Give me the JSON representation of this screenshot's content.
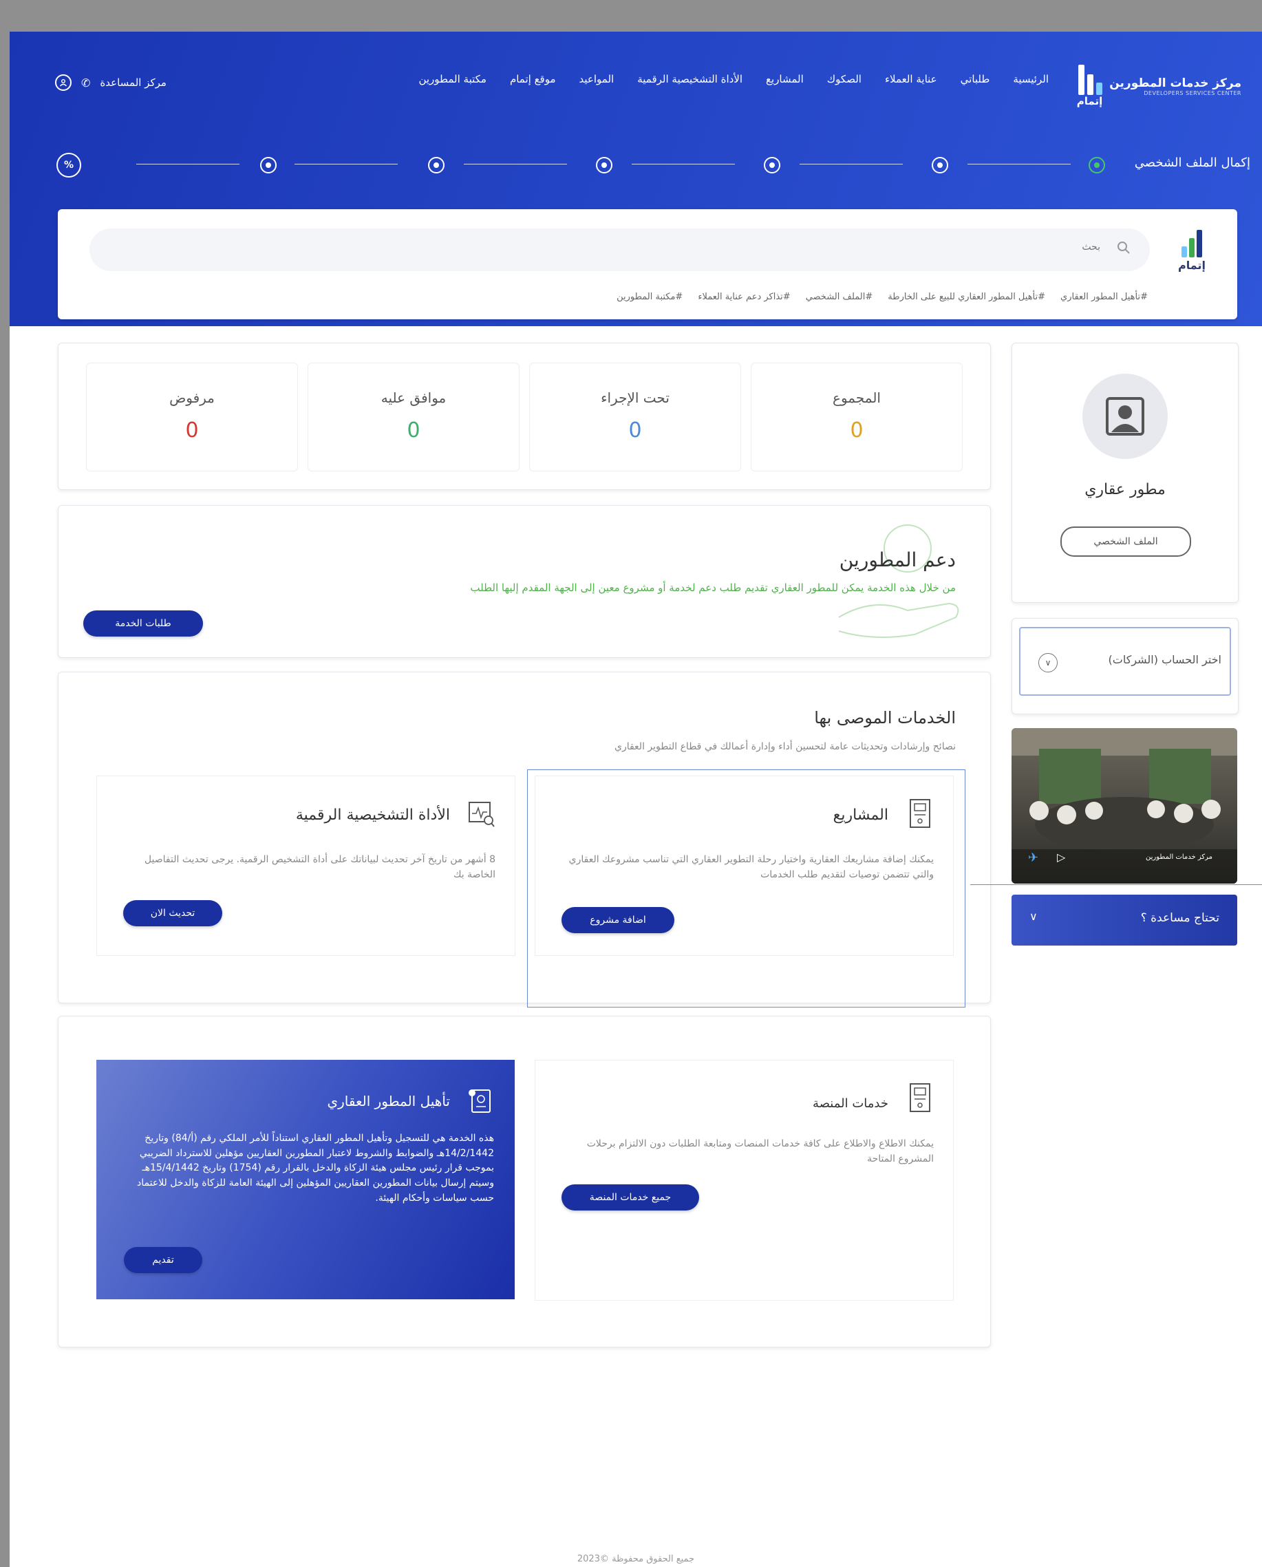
{
  "brand": {
    "name": "مركز خدمات المطورين",
    "name_en": "DEVELOPERS SERVICES CENTER",
    "short": "إتمام"
  },
  "nav": {
    "items": [
      "الرئيسية",
      "طلباتي",
      "عناية العملاء",
      "الصكوك",
      "المشاريع",
      "الأداة التشخيصية الرقمية",
      "المواعيد",
      "موقع إتمام",
      "مكتبة المطورين"
    ],
    "help": "مركز المساعدة"
  },
  "progress": {
    "title": "إكمال الملف الشخصي",
    "percent_symbol": "%",
    "completed_steps": 1,
    "total_steps": 6
  },
  "search": {
    "placeholder": "بحث",
    "logo_text": "إتمام",
    "tags": [
      "#تأهيل المطور العقاري",
      "#تأهيل المطور العقاري للبيع على الخارطة",
      "#الملف الشخصي",
      "#تذاكر دعم عناية العملاء",
      "#مكتبة المطورين"
    ]
  },
  "stats": {
    "items": [
      {
        "label": "المجموع",
        "value": "0",
        "color": "#e0a020"
      },
      {
        "label": "تحت الإجراء",
        "value": "0",
        "color": "#4a8ad6"
      },
      {
        "label": "موافق عليه",
        "value": "0",
        "color": "#3fae6a"
      },
      {
        "label": "مرفوض",
        "value": "0",
        "color": "#d43a2f"
      }
    ]
  },
  "support": {
    "title": "دعم المطورين",
    "description": "من خلال هذه الخدمة يمكن للمطور العقاري تقديم طلب دعم لخدمة أو مشروع معين إلى الجهة المقدم إليها الطلب",
    "button": "طلبات الخدمة"
  },
  "recommended": {
    "title": "الخدمات الموصى بها",
    "subtitle": "نصائح وإرشادات وتحديثات عامة لتحسين أداء وإدارة أعمالك في قطاع التطوير العقاري",
    "services": [
      {
        "title": "المشاريع",
        "description": "يمكنك إضافة مشاريعك العقارية واختيار رحلة التطوير العقاري التي تناسب مشروعك العقاري والتي تتضمن توصيات لتقديم طلب الخدمات",
        "button": "اضافة مشروع",
        "icon": "document-icon"
      },
      {
        "title": "الأداة التشخيصية الرقمية",
        "description": "8 أشهر من تاريخ آخر تحديث لبياناتك على أداة التشخيص الرقمية. يرجى تحديث التفاصيل الخاصة بك",
        "button": "تحديث الان",
        "icon": "diagnostic-icon"
      }
    ]
  },
  "platform": {
    "title": "خدمات المنصة",
    "description": "يمكنك الاطلاع والاطلاع على كافة خدمات المنصات ومتابعة الطلبات دون الالتزام برحلات المشروع المتاحة",
    "button": "جميع خدمات المنصة",
    "icon": "document-icon"
  },
  "qualification": {
    "title": "تأهيل المطور العقاري",
    "description": "هذه الخدمة هي للتسجيل وتأهيل المطور العقاري استناداً للأمر الملكي رقم (أ/84) وتاريخ 14/2/1442هـ والضوابط والشروط لاعتبار المطورين العقاريين مؤهلين للاسترداد الضريبي بموجب قرار رئيس مجلس هيئة الزكاة والدخل بالقرار رقم (1754) وتاريخ 15/4/1442هـ وسيتم إرسال بيانات المطورين العقاريين المؤهلين إلى الهيئة العامة للزكاة والدخل للاعتماد حسب سياسات وأحكام الهيئة.",
    "button": "تقديم",
    "icon": "qualification-icon"
  },
  "profile": {
    "name": "مطور عقاري",
    "button": "الملف الشخصي"
  },
  "account": {
    "label": "اختر الحساب (الشركات)"
  },
  "help": {
    "label": "تحتاج مساعدة ؟"
  },
  "photo_caption": "مركز خدمات المطورين",
  "footer": "جميع الحقوق محفوظة ©2023",
  "colors": {
    "primary": "#1a2fa0",
    "hero": "#2344c4",
    "accent_green": "#4fb24a"
  }
}
